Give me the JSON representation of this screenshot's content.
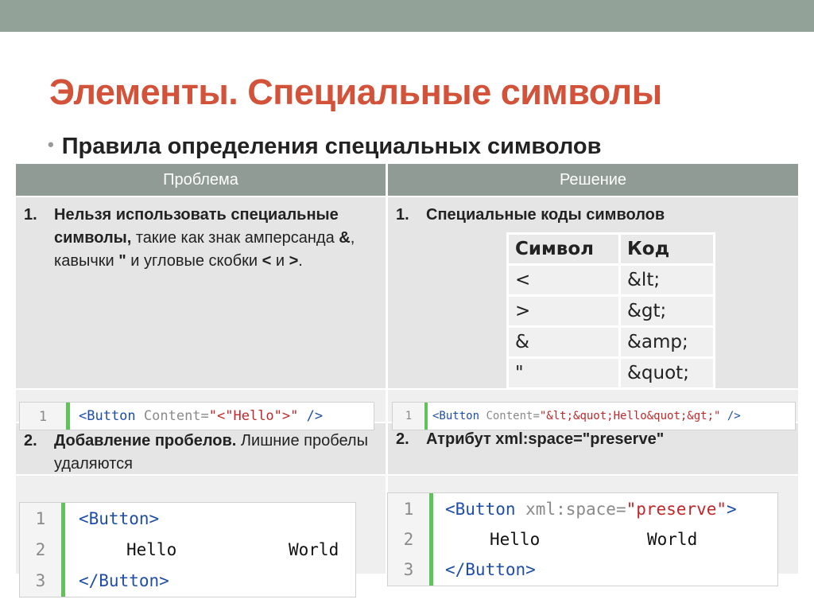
{
  "slide": {
    "title": "Элементы. Специальные символы",
    "subtitle": "Правила определения специальных символов"
  },
  "table": {
    "headers": [
      "Проблема",
      "Решение"
    ]
  },
  "problem1": {
    "num": "1.",
    "bold_lead": "Нельзя использовать специальные символы,",
    "rest_1": " такие как знак амперсанда ",
    "amp": "&",
    "rest_2": ", кавычки ",
    "quot": "\"",
    "rest_3": " и угловые скобки ",
    "lt": "<",
    "rest_4": " и ",
    "gt": ">",
    "rest_5": "."
  },
  "solution1": {
    "num": "1.",
    "text": "Специальные коды символов"
  },
  "codes_table": {
    "headers": [
      "Символ",
      "Код"
    ],
    "rows": [
      [
        "<",
        "&lt;"
      ],
      [
        ">",
        "&gt;"
      ],
      [
        "&",
        "&amp;"
      ],
      [
        "\"",
        "&quot;"
      ]
    ]
  },
  "code1": {
    "line": "1",
    "tag_open": "<Button",
    "attr": " Content=",
    "value": "\"<\"Hello\">\"",
    "tag_close": " />"
  },
  "code2": {
    "line": "1",
    "tag_open": "<Button",
    "attr": " Content=",
    "value": "\"&lt;&quot;Hello&quot;&gt;\"",
    "tag_close": " />"
  },
  "problem2": {
    "num": "2.",
    "bold_lead": "Добавление пробелов.",
    "rest": " Лишние пробелы удаляются"
  },
  "solution2": {
    "num": "2.",
    "text": "Атрибут xml:space=\"preserve\""
  },
  "code3": {
    "lines": [
      "1",
      "2",
      "3"
    ],
    "line1": "<Button>",
    "line2_a": "Hello",
    "line2_b": "World",
    "line3": "</Button>"
  },
  "code4": {
    "lines": [
      "1",
      "2",
      "3"
    ],
    "line1_tag": "<Button",
    "line1_attr": " xml:space=",
    "line1_val": "\"preserve\"",
    "line1_end": ">",
    "line2_a": "Hello",
    "line2_b": "World",
    "line3": "</Button>"
  },
  "colors": {
    "top_bar": "#93a299",
    "title": "#d2533a",
    "header_bg": "#8f9b94",
    "code_bar": "#5fc35a",
    "keyword": "#1f4ea8",
    "string": "#c0282b"
  }
}
